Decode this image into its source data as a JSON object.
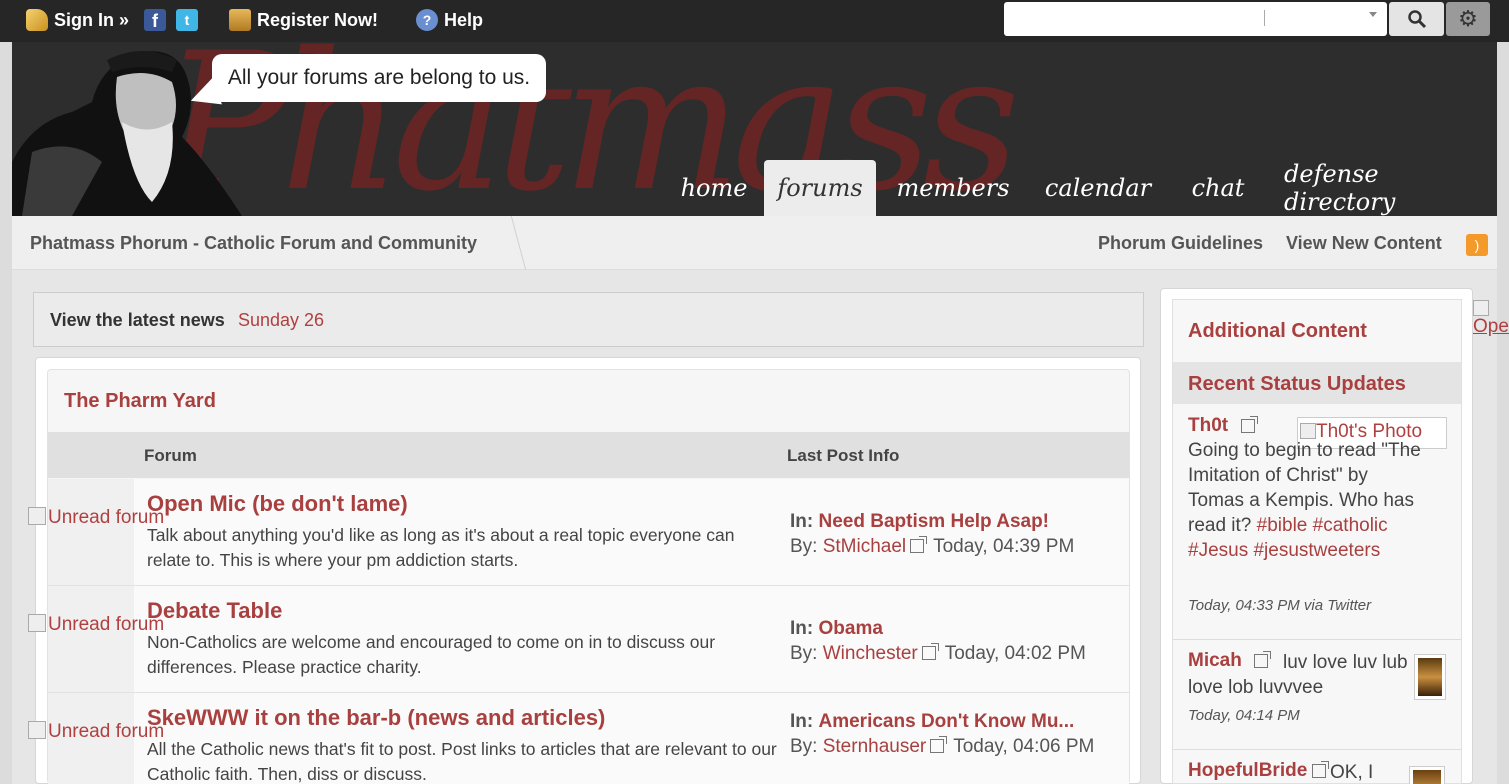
{
  "topbar": {
    "sign_in": "Sign In »",
    "register": "Register Now!",
    "help": "Help",
    "search_value": ""
  },
  "header": {
    "tagline": "All your forums are belong to us.",
    "watermark": "Phatmass",
    "nav": [
      "home",
      "forums",
      "members",
      "calendar",
      "chat",
      "defense directory"
    ],
    "active_nav": "forums"
  },
  "breadcrumb": {
    "title": "Phatmass Phorum - Catholic Forum and Community",
    "links": [
      "Phorum Guidelines",
      "View New Content"
    ]
  },
  "news": {
    "label": "View the latest news",
    "date": "Sunday 26"
  },
  "category": {
    "title": "The Pharm Yard",
    "col_forum": "Forum",
    "col_lastpost": "Last Post Info",
    "forums": [
      {
        "icon_alt": "Unread forum",
        "title": "Open Mic (be don't lame)",
        "desc": "Talk about anything you'd like as long as it's about a real topic everyone can relate to. This is where your pm addiction starts.",
        "in_label": "In:",
        "thread": "Need Baptism Help Asap!",
        "by_label": "By:",
        "user": "StMichael",
        "time": "Today, 04:39 PM"
      },
      {
        "icon_alt": "Unread forum",
        "title": "Debate Table",
        "desc": "Non-Catholics are welcome and encouraged to come on in to discuss our differences. Please practice charity.",
        "in_label": "In:",
        "thread": "Obama",
        "by_label": "By:",
        "user": "Winchester",
        "time": "Today, 04:02 PM"
      },
      {
        "icon_alt": "Unread forum",
        "title": "SkeWWW it on the bar-b (news and articles)",
        "desc": "All the Catholic news that's fit to post. Post links to articles that are relevant to our Catholic faith. Then, diss or discuss.",
        "in_label": "In:",
        "thread": "Americans Don't Know Mu...",
        "by_label": "By:",
        "user": "Sternhauser",
        "time": "Today, 04:06 PM"
      }
    ]
  },
  "sidebar": {
    "title": "Additional Content",
    "status_title": "Recent Status Updates",
    "right_broken": "Ope",
    "statuses": [
      {
        "user": "Th0t",
        "photo_alt": "Th0t's Photo",
        "text": "Going to begin to read \"The Imitation of Christ\" by Tomas a Kempis. Who has read it?",
        "tags": [
          "#bible",
          "#catholic",
          "#Jesus",
          "#jesustweeters"
        ],
        "meta": "Today, 04:33 PM via Twitter"
      },
      {
        "user": "Micah",
        "text": "luv love luv lub love lob luvvvee",
        "meta": "Today, 04:14 PM"
      },
      {
        "user": "HopefulBride",
        "text": "OK, I"
      }
    ]
  },
  "colors": {
    "accent": "#a8403f",
    "topbar": "#262626",
    "header": "#2d2d2d"
  }
}
